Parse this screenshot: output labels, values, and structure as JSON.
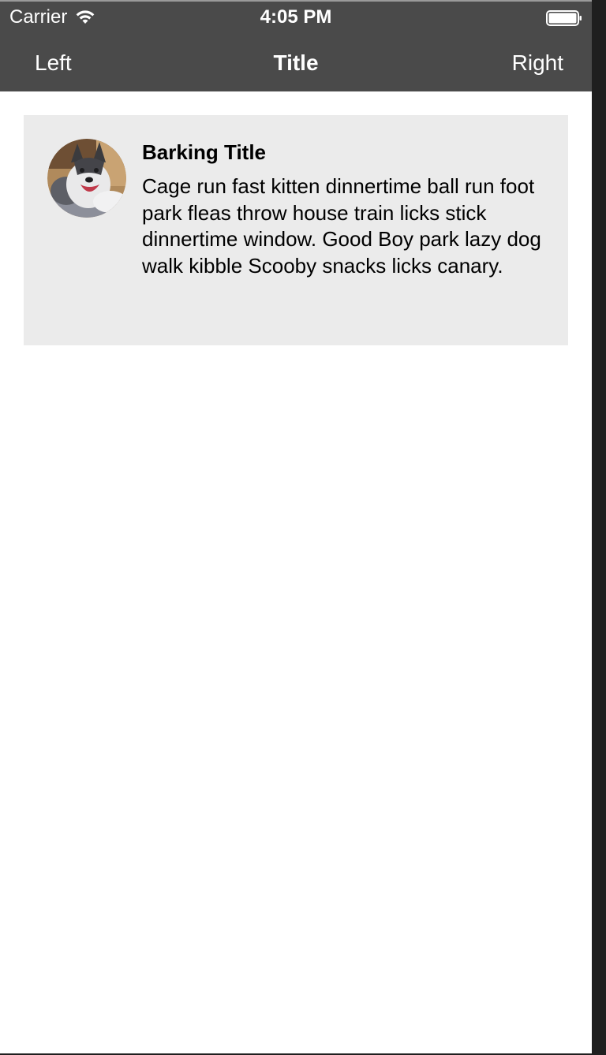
{
  "status_bar": {
    "carrier": "Carrier",
    "time": "4:05 PM",
    "wifi_icon": "wifi-icon",
    "battery_icon": "battery-icon"
  },
  "nav_bar": {
    "left_label": "Left",
    "title": "Title",
    "right_label": "Right"
  },
  "card": {
    "avatar_icon": "husky-avatar",
    "title": "Barking Title",
    "body": "Cage run fast kitten dinnertime ball run foot park fleas throw house train licks stick dinnertime window. Good Boy park lazy dog walk kibble Scooby snacks licks canary."
  },
  "colors": {
    "header_bg": "#4a4a4a",
    "card_bg": "#ebebeb",
    "page_bg": "#ffffff"
  }
}
